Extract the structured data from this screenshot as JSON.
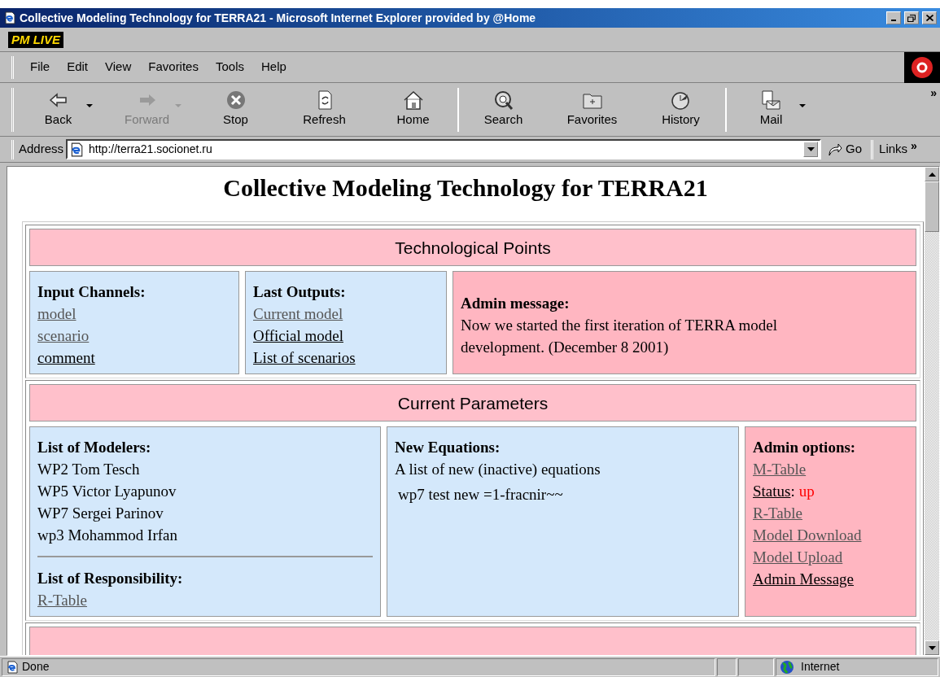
{
  "window": {
    "title": "Collective Modeling Technology for TERRA21 - Microsoft Internet Explorer provided by @Home"
  },
  "brand": "PM LIVE",
  "menu": [
    "File",
    "Edit",
    "View",
    "Favorites",
    "Tools",
    "Help"
  ],
  "toolbar": [
    {
      "kind": "back",
      "label": "Back",
      "disabled": false,
      "dropdown": true
    },
    {
      "kind": "forward",
      "label": "Forward",
      "disabled": true,
      "dropdown": true
    },
    {
      "kind": "stop",
      "label": "Stop",
      "disabled": false,
      "dropdown": false
    },
    {
      "kind": "refresh",
      "label": "Refresh",
      "disabled": false,
      "dropdown": false
    },
    {
      "kind": "home",
      "label": "Home",
      "disabled": false,
      "dropdown": false
    },
    {
      "kind": "search",
      "label": "Search",
      "disabled": false,
      "dropdown": false
    },
    {
      "kind": "favorites",
      "label": "Favorites",
      "disabled": false,
      "dropdown": false
    },
    {
      "kind": "history",
      "label": "History",
      "disabled": false,
      "dropdown": false
    },
    {
      "kind": "mail",
      "label": "Mail",
      "disabled": false,
      "dropdown": true
    }
  ],
  "toolbar_more": "»",
  "address": {
    "label": "Address",
    "url": "http://terra21.socionet.ru",
    "go": "Go",
    "links": "Links",
    "links_more": "»"
  },
  "page": {
    "heading": "Collective Modeling Technology for TERRA21",
    "sections": [
      {
        "header": "Technological Points",
        "cells": [
          {
            "color": "#d4e8fb",
            "blocks": [
              {
                "kind": "heading",
                "text": "Input Channels:"
              },
              {
                "kind": "link",
                "text": "model",
                "visited": true
              },
              {
                "kind": "link",
                "text": "scenario",
                "visited": true
              },
              {
                "kind": "link",
                "text": "comment",
                "visited": false
              }
            ]
          },
          {
            "color": "#d4e8fb",
            "blocks": [
              {
                "kind": "heading",
                "text": "Last Outputs:"
              },
              {
                "kind": "link",
                "text": "Current model",
                "visited": true
              },
              {
                "kind": "link",
                "text": "Official model",
                "visited": false
              },
              {
                "kind": "link",
                "text": "List of scenarios",
                "visited": false
              }
            ]
          },
          {
            "color": "#ffb6c1",
            "blocks": [
              {
                "kind": "heading",
                "text": "Admin message:"
              },
              {
                "kind": "text",
                "text": "Now we started the first iteration of TERRA model development. (December 8 2001)"
              }
            ]
          }
        ]
      },
      {
        "header": "Current Parameters",
        "cells": [
          {
            "color": "#d4e8fb",
            "blocks": [
              {
                "kind": "heading",
                "text": "List of Modelers:"
              },
              {
                "kind": "text",
                "text": "WP2 Tom Tesch"
              },
              {
                "kind": "text",
                "text": "WP5 Victor Lyapunov"
              },
              {
                "kind": "text",
                "text": "WP7 Sergei Parinov"
              },
              {
                "kind": "text",
                "text": "wp3 Mohammod Irfan"
              },
              {
                "kind": "rule"
              },
              {
                "kind": "heading",
                "text": "List of Responsibility:"
              },
              {
                "kind": "link",
                "text": "R-Table",
                "visited": true
              }
            ]
          },
          {
            "color": "#d4e8fb",
            "blocks": [
              {
                "kind": "heading",
                "text": "New Equations:"
              },
              {
                "kind": "text",
                "text": "A list of new (inactive) equations"
              },
              {
                "kind": "equation",
                "text": "wp7 test new =1-fracnir~~"
              }
            ]
          },
          {
            "color": "#ffb6c1",
            "blocks": [
              {
                "kind": "heading",
                "text": "Admin options:"
              },
              {
                "kind": "link",
                "text": "M-Table",
                "visited": true
              },
              {
                "kind": "status",
                "label": "Status",
                "separator": ":",
                "value": "up"
              },
              {
                "kind": "link",
                "text": "R-Table",
                "visited": true
              },
              {
                "kind": "link",
                "text": "Model Download",
                "visited": true
              },
              {
                "kind": "link",
                "text": "Model Upload",
                "visited": true
              },
              {
                "kind": "link",
                "text": "Admin Message",
                "visited": false
              }
            ]
          }
        ]
      }
    ]
  },
  "status_bar": {
    "text": "Done",
    "zone": "Internet"
  }
}
